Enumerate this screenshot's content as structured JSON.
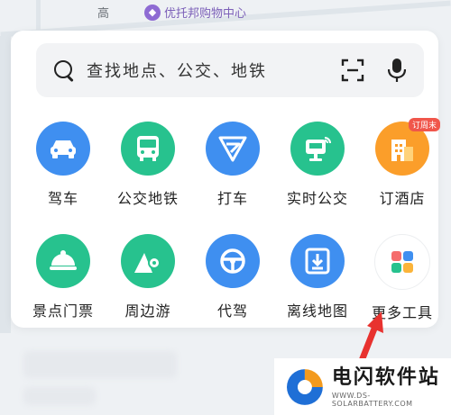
{
  "map": {
    "label_left": "高",
    "poi_name": "优托邦购物中心"
  },
  "search": {
    "placeholder": "查找地点、公交、地铁"
  },
  "tools": [
    {
      "label": "驾车",
      "icon": "car-icon",
      "color": "#3f8ff0"
    },
    {
      "label": "公交地铁",
      "icon": "bus-icon",
      "color": "#27c28e"
    },
    {
      "label": "打车",
      "icon": "taxi-icon",
      "color": "#3f8ff0"
    },
    {
      "label": "实时公交",
      "icon": "realtime-bus-icon",
      "color": "#27c28e"
    },
    {
      "label": "订酒店",
      "icon": "hotel-icon",
      "color": "#fb9e2a",
      "badge": "订周末"
    },
    {
      "label": "景点门票",
      "icon": "scenic-icon",
      "color": "#27c28e"
    },
    {
      "label": "周边游",
      "icon": "nearby-trip-icon",
      "color": "#27c28e"
    },
    {
      "label": "代驾",
      "icon": "steering-wheel-icon",
      "color": "#3f8ff0"
    },
    {
      "label": "离线地图",
      "icon": "offline-map-icon",
      "color": "#3f8ff0"
    },
    {
      "label": "更多工具",
      "icon": "more-tools-icon",
      "color": "#ffffff"
    }
  ],
  "watermark": {
    "title": "电闪软件站",
    "subtitle": "WWW.DS-SOLARBATTERY.COM"
  }
}
